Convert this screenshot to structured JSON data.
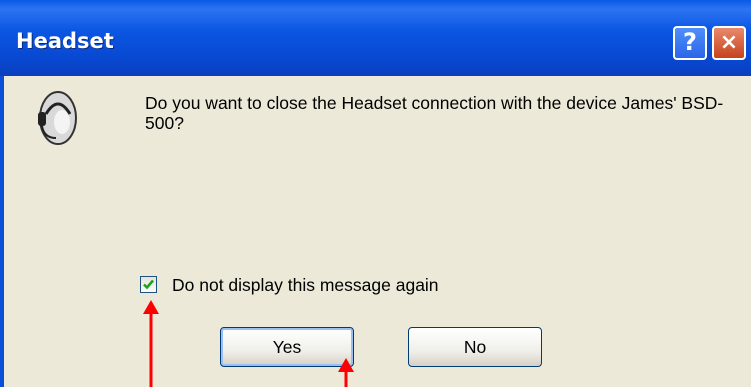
{
  "window": {
    "title": "Headset"
  },
  "titlebar": {
    "help_label": "?",
    "close_label": "×"
  },
  "message": {
    "text": "Do you want to close the Headset connection with the device James' BSD-500?"
  },
  "checkbox": {
    "label": "Do not display this message again",
    "checked": true
  },
  "buttons": {
    "yes_label": "Yes",
    "no_label": "No"
  },
  "colors": {
    "titlebar": "#0b56e3",
    "dialog_bg": "#ece9d8",
    "arrow": "#ff0000",
    "checkmark": "#21a121"
  },
  "icons": {
    "dialog_icon": "headset-person-icon",
    "check_icon": "checkmark-icon",
    "annotation": "red-arrow-icon"
  }
}
